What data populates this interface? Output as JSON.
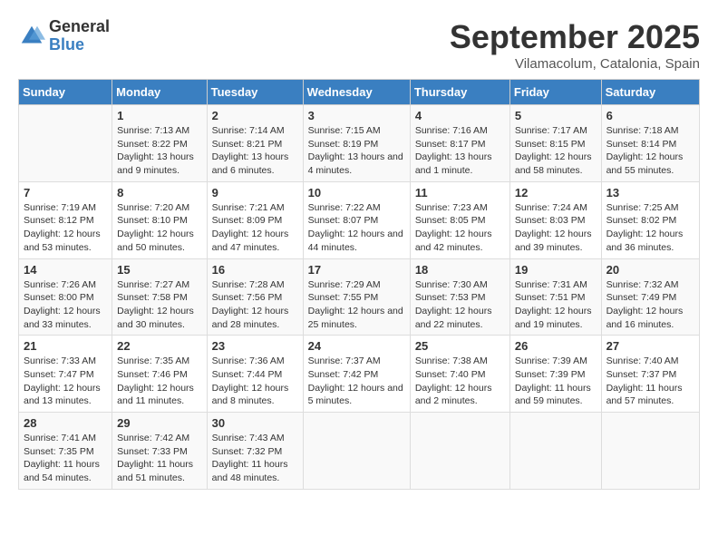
{
  "logo": {
    "general": "General",
    "blue": "Blue"
  },
  "title": "September 2025",
  "subtitle": "Vilamacolum, Catalonia, Spain",
  "days_header": [
    "Sunday",
    "Monday",
    "Tuesday",
    "Wednesday",
    "Thursday",
    "Friday",
    "Saturday"
  ],
  "weeks": [
    [
      {
        "num": "",
        "sunrise": "",
        "sunset": "",
        "daylight": ""
      },
      {
        "num": "1",
        "sunrise": "Sunrise: 7:13 AM",
        "sunset": "Sunset: 8:22 PM",
        "daylight": "Daylight: 13 hours and 9 minutes."
      },
      {
        "num": "2",
        "sunrise": "Sunrise: 7:14 AM",
        "sunset": "Sunset: 8:21 PM",
        "daylight": "Daylight: 13 hours and 6 minutes."
      },
      {
        "num": "3",
        "sunrise": "Sunrise: 7:15 AM",
        "sunset": "Sunset: 8:19 PM",
        "daylight": "Daylight: 13 hours and 4 minutes."
      },
      {
        "num": "4",
        "sunrise": "Sunrise: 7:16 AM",
        "sunset": "Sunset: 8:17 PM",
        "daylight": "Daylight: 13 hours and 1 minute."
      },
      {
        "num": "5",
        "sunrise": "Sunrise: 7:17 AM",
        "sunset": "Sunset: 8:15 PM",
        "daylight": "Daylight: 12 hours and 58 minutes."
      },
      {
        "num": "6",
        "sunrise": "Sunrise: 7:18 AM",
        "sunset": "Sunset: 8:14 PM",
        "daylight": "Daylight: 12 hours and 55 minutes."
      }
    ],
    [
      {
        "num": "7",
        "sunrise": "Sunrise: 7:19 AM",
        "sunset": "Sunset: 8:12 PM",
        "daylight": "Daylight: 12 hours and 53 minutes."
      },
      {
        "num": "8",
        "sunrise": "Sunrise: 7:20 AM",
        "sunset": "Sunset: 8:10 PM",
        "daylight": "Daylight: 12 hours and 50 minutes."
      },
      {
        "num": "9",
        "sunrise": "Sunrise: 7:21 AM",
        "sunset": "Sunset: 8:09 PM",
        "daylight": "Daylight: 12 hours and 47 minutes."
      },
      {
        "num": "10",
        "sunrise": "Sunrise: 7:22 AM",
        "sunset": "Sunset: 8:07 PM",
        "daylight": "Daylight: 12 hours and 44 minutes."
      },
      {
        "num": "11",
        "sunrise": "Sunrise: 7:23 AM",
        "sunset": "Sunset: 8:05 PM",
        "daylight": "Daylight: 12 hours and 42 minutes."
      },
      {
        "num": "12",
        "sunrise": "Sunrise: 7:24 AM",
        "sunset": "Sunset: 8:03 PM",
        "daylight": "Daylight: 12 hours and 39 minutes."
      },
      {
        "num": "13",
        "sunrise": "Sunrise: 7:25 AM",
        "sunset": "Sunset: 8:02 PM",
        "daylight": "Daylight: 12 hours and 36 minutes."
      }
    ],
    [
      {
        "num": "14",
        "sunrise": "Sunrise: 7:26 AM",
        "sunset": "Sunset: 8:00 PM",
        "daylight": "Daylight: 12 hours and 33 minutes."
      },
      {
        "num": "15",
        "sunrise": "Sunrise: 7:27 AM",
        "sunset": "Sunset: 7:58 PM",
        "daylight": "Daylight: 12 hours and 30 minutes."
      },
      {
        "num": "16",
        "sunrise": "Sunrise: 7:28 AM",
        "sunset": "Sunset: 7:56 PM",
        "daylight": "Daylight: 12 hours and 28 minutes."
      },
      {
        "num": "17",
        "sunrise": "Sunrise: 7:29 AM",
        "sunset": "Sunset: 7:55 PM",
        "daylight": "Daylight: 12 hours and 25 minutes."
      },
      {
        "num": "18",
        "sunrise": "Sunrise: 7:30 AM",
        "sunset": "Sunset: 7:53 PM",
        "daylight": "Daylight: 12 hours and 22 minutes."
      },
      {
        "num": "19",
        "sunrise": "Sunrise: 7:31 AM",
        "sunset": "Sunset: 7:51 PM",
        "daylight": "Daylight: 12 hours and 19 minutes."
      },
      {
        "num": "20",
        "sunrise": "Sunrise: 7:32 AM",
        "sunset": "Sunset: 7:49 PM",
        "daylight": "Daylight: 12 hours and 16 minutes."
      }
    ],
    [
      {
        "num": "21",
        "sunrise": "Sunrise: 7:33 AM",
        "sunset": "Sunset: 7:47 PM",
        "daylight": "Daylight: 12 hours and 13 minutes."
      },
      {
        "num": "22",
        "sunrise": "Sunrise: 7:35 AM",
        "sunset": "Sunset: 7:46 PM",
        "daylight": "Daylight: 12 hours and 11 minutes."
      },
      {
        "num": "23",
        "sunrise": "Sunrise: 7:36 AM",
        "sunset": "Sunset: 7:44 PM",
        "daylight": "Daylight: 12 hours and 8 minutes."
      },
      {
        "num": "24",
        "sunrise": "Sunrise: 7:37 AM",
        "sunset": "Sunset: 7:42 PM",
        "daylight": "Daylight: 12 hours and 5 minutes."
      },
      {
        "num": "25",
        "sunrise": "Sunrise: 7:38 AM",
        "sunset": "Sunset: 7:40 PM",
        "daylight": "Daylight: 12 hours and 2 minutes."
      },
      {
        "num": "26",
        "sunrise": "Sunrise: 7:39 AM",
        "sunset": "Sunset: 7:39 PM",
        "daylight": "Daylight: 11 hours and 59 minutes."
      },
      {
        "num": "27",
        "sunrise": "Sunrise: 7:40 AM",
        "sunset": "Sunset: 7:37 PM",
        "daylight": "Daylight: 11 hours and 57 minutes."
      }
    ],
    [
      {
        "num": "28",
        "sunrise": "Sunrise: 7:41 AM",
        "sunset": "Sunset: 7:35 PM",
        "daylight": "Daylight: 11 hours and 54 minutes."
      },
      {
        "num": "29",
        "sunrise": "Sunrise: 7:42 AM",
        "sunset": "Sunset: 7:33 PM",
        "daylight": "Daylight: 11 hours and 51 minutes."
      },
      {
        "num": "30",
        "sunrise": "Sunrise: 7:43 AM",
        "sunset": "Sunset: 7:32 PM",
        "daylight": "Daylight: 11 hours and 48 minutes."
      },
      {
        "num": "",
        "sunrise": "",
        "sunset": "",
        "daylight": ""
      },
      {
        "num": "",
        "sunrise": "",
        "sunset": "",
        "daylight": ""
      },
      {
        "num": "",
        "sunrise": "",
        "sunset": "",
        "daylight": ""
      },
      {
        "num": "",
        "sunrise": "",
        "sunset": "",
        "daylight": ""
      }
    ]
  ]
}
